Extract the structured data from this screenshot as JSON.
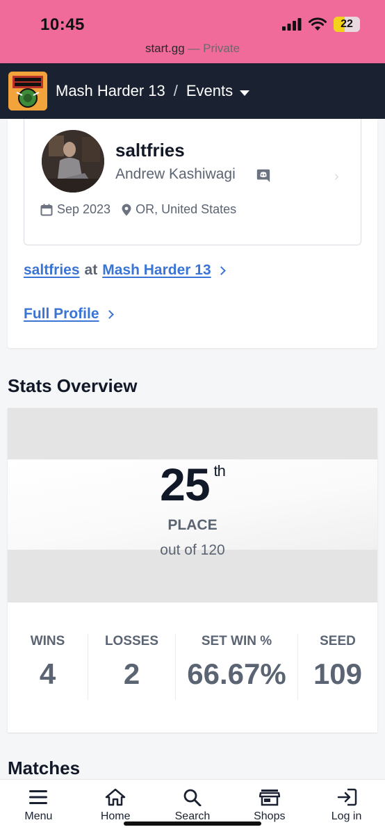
{
  "status_bar": {
    "time": "10:45",
    "battery": "22"
  },
  "browser": {
    "domain": "start.gg",
    "private_label": "— Private"
  },
  "nav": {
    "tournament": "Mash Harder 13",
    "separator": "/",
    "section": "Events"
  },
  "profile": {
    "gamer_tag": "saltfries",
    "real_name": "Andrew Kashiwagi",
    "joined": "Sep 2023",
    "location": "OR, United States",
    "at_link": {
      "player": "saltfries",
      "at": "at",
      "tournament": "Mash Harder 13"
    },
    "full_profile_label": "Full Profile"
  },
  "stats": {
    "title": "Stats Overview",
    "place": "25",
    "place_suffix": "th",
    "place_label": "PLACE",
    "out_of": "out of 120",
    "items": [
      {
        "label": "WINS",
        "value": "4"
      },
      {
        "label": "LOSSES",
        "value": "2"
      },
      {
        "label": "SET WIN %",
        "value": "66.67%"
      },
      {
        "label": "SEED",
        "value": "109"
      }
    ]
  },
  "matches": {
    "title": "Matches"
  },
  "bottom_nav": {
    "items": [
      {
        "label": "Menu",
        "icon": "menu-icon"
      },
      {
        "label": "Home",
        "icon": "home-icon"
      },
      {
        "label": "Search",
        "icon": "search-icon"
      },
      {
        "label": "Shops",
        "icon": "shop-icon"
      },
      {
        "label": "Log in",
        "icon": "login-icon"
      }
    ]
  }
}
